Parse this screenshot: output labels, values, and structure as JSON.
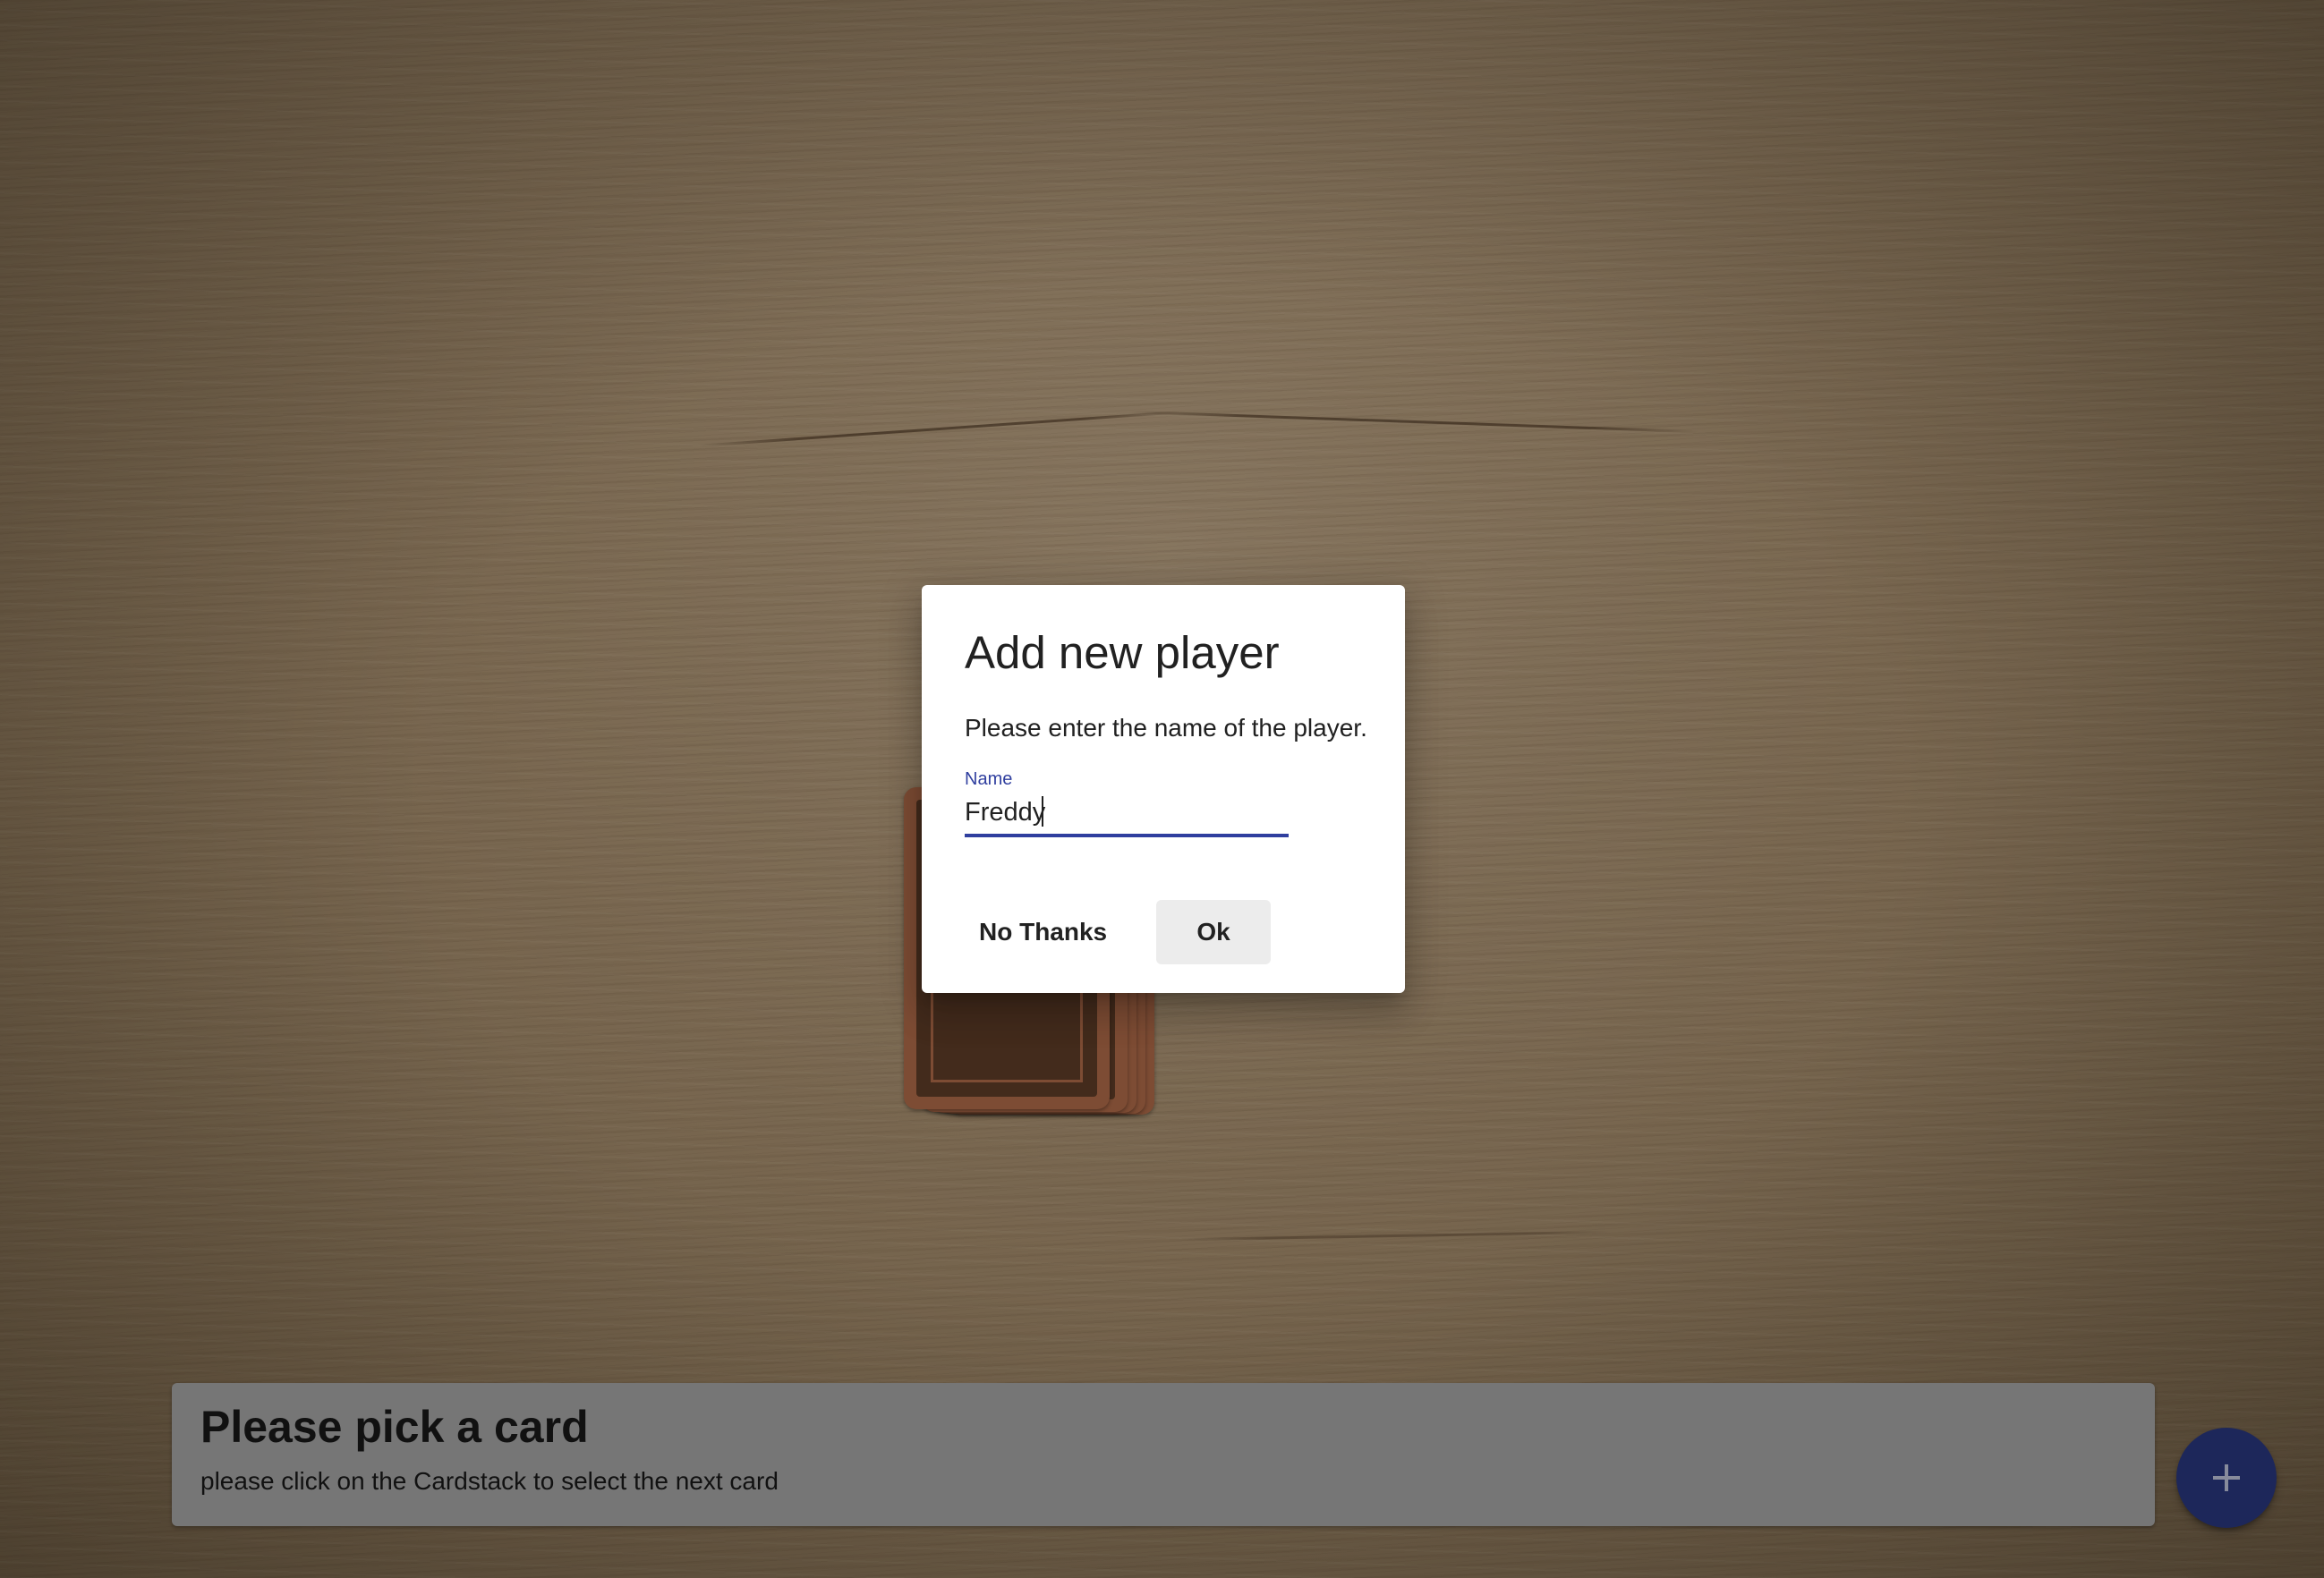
{
  "dialog": {
    "title": "Add new player",
    "text": "Please enter the name of the player.",
    "name_field": {
      "label": "Name",
      "value": "Freddy"
    },
    "cancel_label": "No Thanks",
    "ok_label": "Ok"
  },
  "info_bar": {
    "title": "Please pick a card",
    "subtitle": "please click on the Cardstack to select the next card"
  },
  "fab": {
    "icon": "plus-icon"
  },
  "colors": {
    "primary": "#303f9f",
    "fab": "#2c3a85",
    "card_edge": "#b8704d",
    "card_face": "#64402a",
    "info_bar": "#aeaeae"
  }
}
